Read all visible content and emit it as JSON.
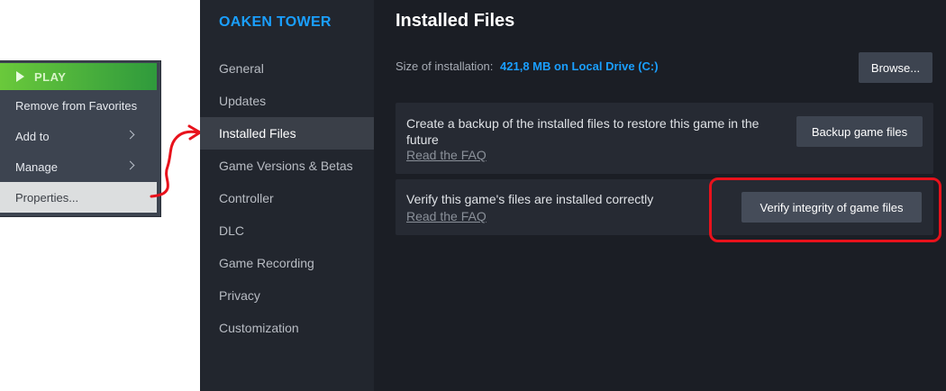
{
  "context_menu": {
    "play_label": "PLAY",
    "items": [
      {
        "label": "Remove from Favorites",
        "has_submenu": false
      },
      {
        "label": "Add to",
        "has_submenu": true
      },
      {
        "label": "Manage",
        "has_submenu": true
      },
      {
        "label": "Properties...",
        "has_submenu": false,
        "selected": true
      }
    ]
  },
  "sidebar": {
    "game_title": "OAKEN TOWER",
    "items": [
      {
        "label": "General"
      },
      {
        "label": "Updates"
      },
      {
        "label": "Installed Files",
        "active": true
      },
      {
        "label": "Game Versions & Betas"
      },
      {
        "label": "Controller"
      },
      {
        "label": "DLC"
      },
      {
        "label": "Game Recording"
      },
      {
        "label": "Privacy"
      },
      {
        "label": "Customization"
      }
    ]
  },
  "main": {
    "title": "Installed Files",
    "size_label": "Size of installation:",
    "size_value": "421,8 MB on Local Drive (C:)",
    "browse_label": "Browse...",
    "backup_card": {
      "text": "Create a backup of the installed files to restore this game in the future",
      "link": "Read the FAQ",
      "button": "Backup game files"
    },
    "verify_card": {
      "text": "Verify this game's files are installed correctly",
      "link": "Read the FAQ",
      "button": "Verify integrity of game files"
    }
  },
  "colors": {
    "accent": "#1a9fff",
    "annotation": "#e8121c",
    "play_green": "#5cb85c"
  }
}
